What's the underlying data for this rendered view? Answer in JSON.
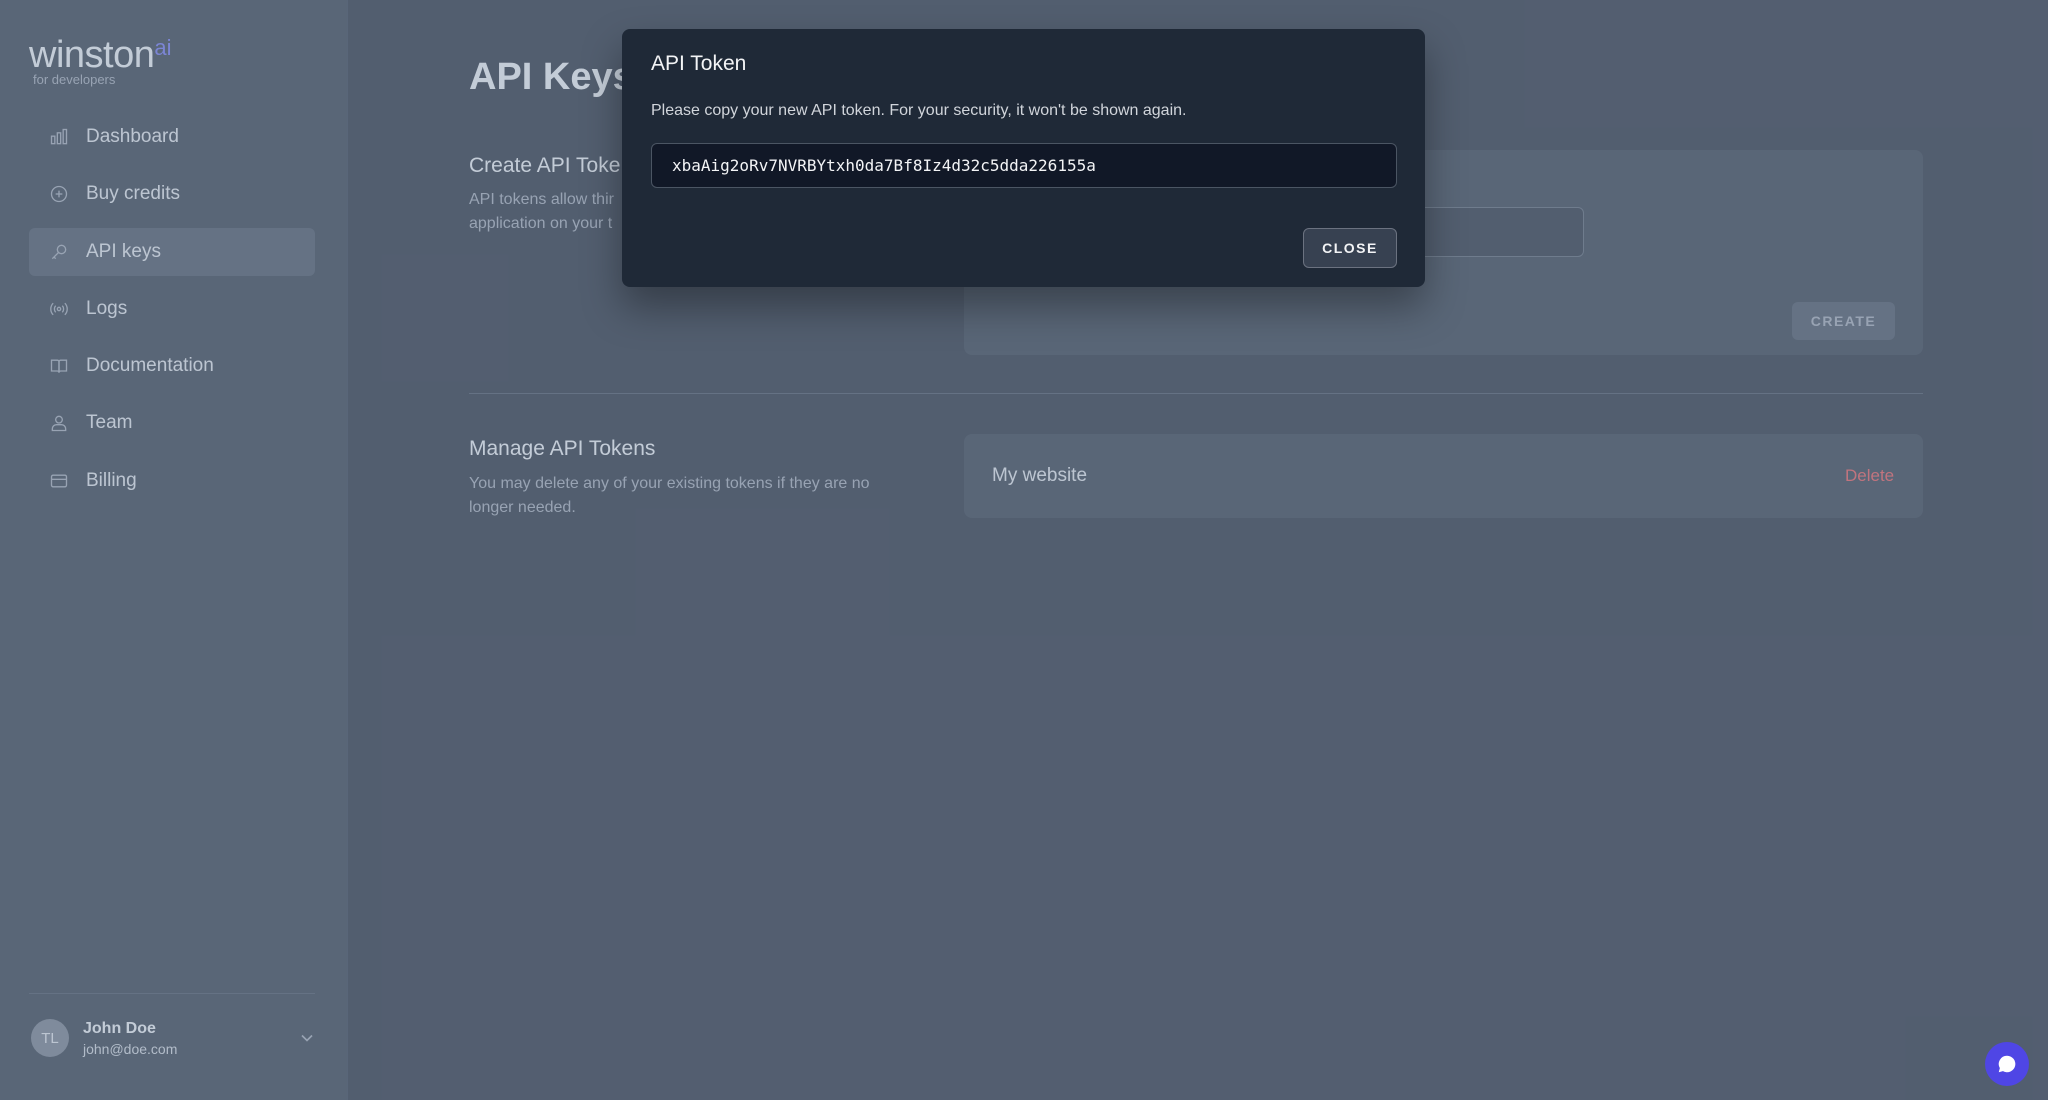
{
  "brand": {
    "name": "winston",
    "suffix": "ai",
    "tagline": "for developers"
  },
  "sidebar": {
    "items": [
      {
        "label": "Dashboard",
        "icon": "chart-bar-icon",
        "active": false
      },
      {
        "label": "Buy credits",
        "icon": "plus-circle-icon",
        "active": false
      },
      {
        "label": "API keys",
        "icon": "key-icon",
        "active": true
      },
      {
        "label": "Logs",
        "icon": "signal-icon",
        "active": false
      },
      {
        "label": "Documentation",
        "icon": "book-open-icon",
        "active": false
      },
      {
        "label": "Team",
        "icon": "users-icon",
        "active": false
      },
      {
        "label": "Billing",
        "icon": "credit-card-icon",
        "active": false
      }
    ]
  },
  "user": {
    "initials": "TL",
    "name": "John Doe",
    "email": "john@doe.com"
  },
  "page": {
    "title": "API Keys"
  },
  "create_section": {
    "title": "Create API Toke",
    "description_line1": "API tokens allow thir",
    "description_line2": "application on your t",
    "create_label": "CREATE"
  },
  "manage_section": {
    "title": "Manage API Tokens",
    "description_line1": "You may delete any of your existing tokens if they are no",
    "description_line2": "longer needed.",
    "tokens": [
      {
        "name": "My website",
        "delete_label": "Delete"
      }
    ]
  },
  "modal": {
    "title": "API Token",
    "description": "Please copy your new API token. For your security, it won't be shown again.",
    "token": "xbaAig2oRv7NVRBYtxh0da7Bf8Iz4d32c5dda226155a",
    "close_label": "CLOSE"
  },
  "colors": {
    "accent": "#4f46e5",
    "danger": "#ef4444",
    "sidebar_bg": "#1f2937",
    "page_bg": "#111827"
  }
}
